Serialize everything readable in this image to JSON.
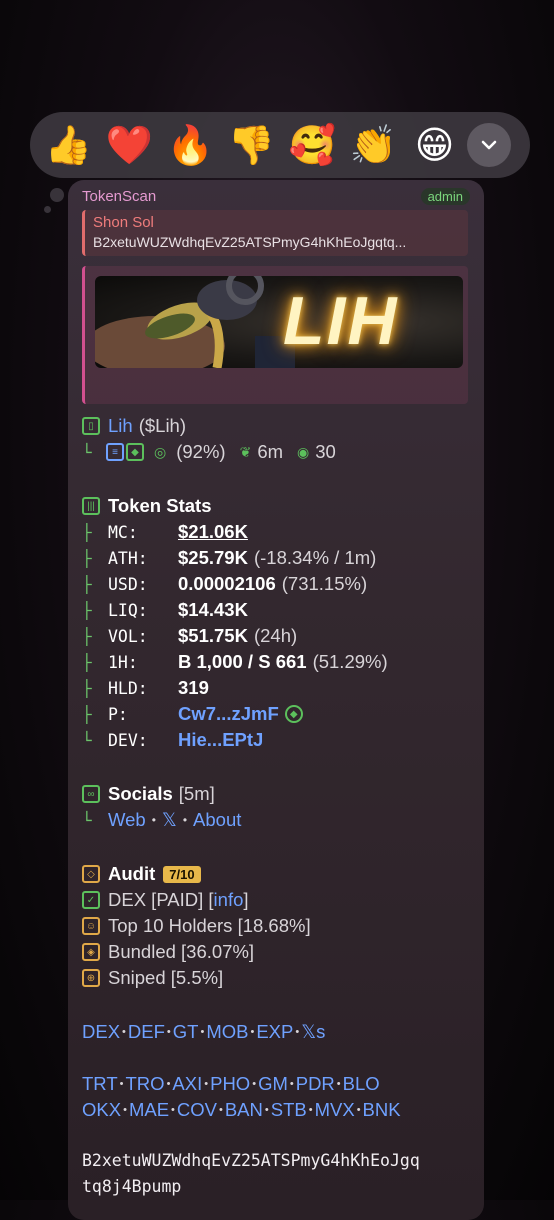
{
  "reactions": {
    "emojis": [
      "👍",
      "❤️",
      "🔥",
      "👎",
      "🥰",
      "👏",
      "😁"
    ],
    "more_icon": "chevron-down-icon"
  },
  "message": {
    "sender": "TokenScan",
    "badge": "admin",
    "reply": {
      "name": "Shon Sol",
      "text": "B2xetuWUZWdhqEvZ25ATSPmyG4hKhEoJgqtq..."
    },
    "banner_text": "LIH",
    "token": {
      "name": "Lih",
      "ticker": "($Lih)",
      "percent": "(92%)",
      "age": "6m",
      "views": "30"
    },
    "stats": {
      "title": "Token Stats",
      "rows": [
        {
          "label": "MC:",
          "value": "$21.06K",
          "extra": ""
        },
        {
          "label": "ATH:",
          "value": "$25.79K",
          "extra": "(-18.34% / 1m)"
        },
        {
          "label": "USD:",
          "value": "0.00002106",
          "extra": "(731.15%)"
        },
        {
          "label": "LIQ:",
          "value": "$14.43K",
          "extra": ""
        },
        {
          "label": "VOL:",
          "value": "$51.75K",
          "extra": "(24h)"
        },
        {
          "label": "1H:",
          "value": "B 1,000 / S 661",
          "extra": "(51.29%)"
        },
        {
          "label": "HLD:",
          "value": "319",
          "extra": ""
        },
        {
          "label": "P:",
          "value": "Cw7...zJmF",
          "extra": ""
        },
        {
          "label": "DEV:",
          "value": "Hie...EPtJ",
          "extra": ""
        }
      ]
    },
    "socials": {
      "title": "Socials",
      "time": "[5m]",
      "web": "Web",
      "x": "𝕏",
      "about": "About",
      "sep": "•"
    },
    "audit": {
      "title": "Audit",
      "score": "7/10",
      "dex": "DEX [PAID] [",
      "dex_link": "info",
      "dex_end": "]",
      "top10": "Top 10 Holders [18.68%]",
      "bundled": "Bundled [36.07%]",
      "sniped": "Sniped [5.5%]"
    },
    "links1": [
      "DEX",
      "DEF",
      "GT",
      "MOB",
      "EXP",
      "𝕏s"
    ],
    "links2": [
      "TRT",
      "TRO",
      "AXI",
      "PHO",
      "GM",
      "PDR",
      "BLO"
    ],
    "links3": [
      "OKX",
      "MAE",
      "COV",
      "BAN",
      "STB",
      "MVX",
      "BNK"
    ],
    "sep": "•",
    "address_line1": "B2xetuWUZWdhqEvZ25ATSPmyG4hKhEoJgq",
    "address_line2": "tq8j4Bpump"
  }
}
